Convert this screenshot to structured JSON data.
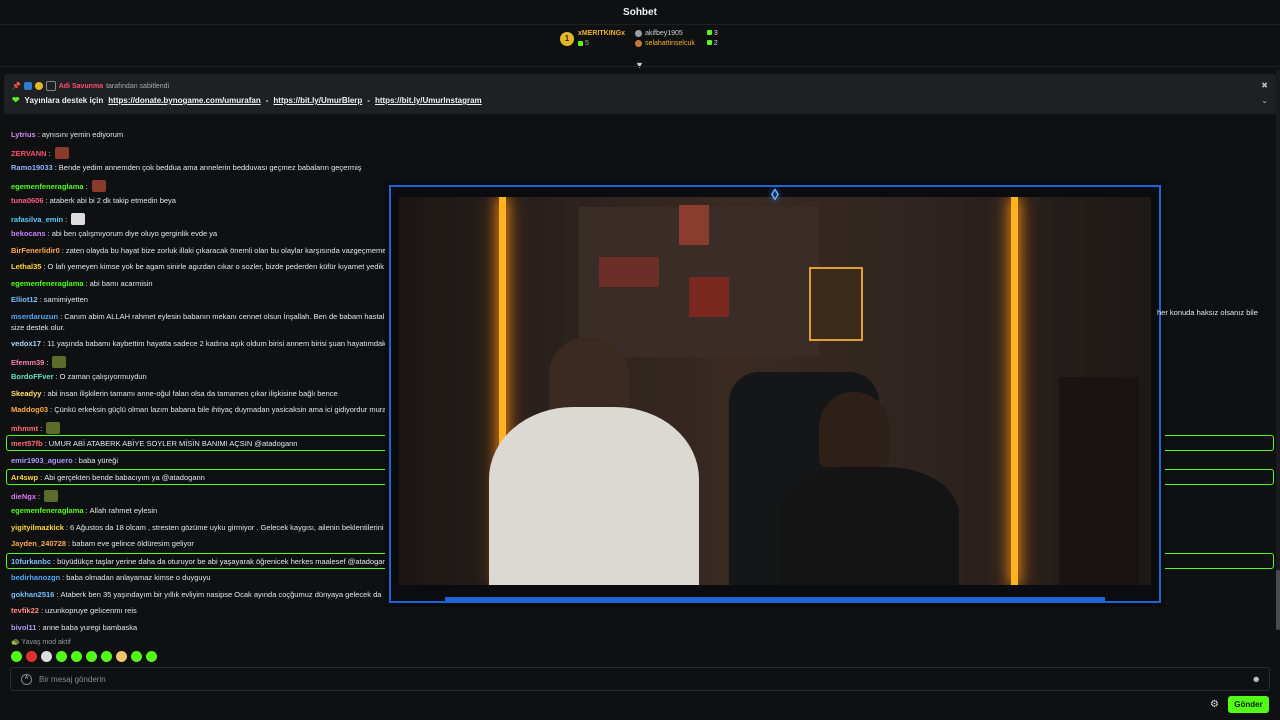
{
  "header": {
    "title": "Sohbet"
  },
  "leaderboard": {
    "first": {
      "rank": "1",
      "name": "xMERITKINGx",
      "count": "5"
    },
    "others": [
      {
        "name": "akifbey1905",
        "count": "3"
      },
      {
        "name": "selahattinselcuk",
        "count": "2"
      }
    ]
  },
  "pinned": {
    "pinned_by": "Adi Savunma",
    "pinned_suffix": "tarafından sabitlendi",
    "support_text": "Yayınlara destek için",
    "link1": "https://donate.bynogame.com/umurafan",
    "sep": "-",
    "link2": "https://bit.ly/UmurBlerp",
    "link3": "https://bit.ly/UmurInstagram"
  },
  "messages": [
    {
      "user": "Lytrius",
      "color": "#d48cff",
      "text": "aynısını yemin ediyorum"
    },
    {
      "user": "ZERVANN",
      "color": "#ff4d6d",
      "text": ""
    },
    {
      "user": "Ramo19033",
      "color": "#8ab4ff",
      "text": "Bende yedim annemden çok beddua ama annelerin bedduvası geçmez babaların geçermiş"
    },
    {
      "user": "egemenfeneraglama",
      "color": "#53fc18",
      "text": ""
    },
    {
      "user": "tuna0606",
      "color": "#ff5c8a",
      "text": "ataberk abi bi 2 dk takip etmedin beya"
    },
    {
      "user": "rafasilva_emin",
      "color": "#5cc8ff",
      "text": ""
    },
    {
      "user": "bekocans",
      "color": "#c77dff",
      "text": "abi ben çalışmıyorum diye oluyo gerginlik evde ya"
    },
    {
      "user": "BirFenerlidir0",
      "color": "#ffa94d",
      "text": "zaten olayda bu hayat bize zorluk illaki çıkaracak önemli olan bu olaylar karşısında vazgeçmemek"
    },
    {
      "user": "Lethal35",
      "color": "#ffd43b",
      "text": "O lafı yemeyen kimse yok be agam sinirle agızdan cıkar o sozler, bizde pederden küfür kıyamet yedik"
    },
    {
      "user": "egemenfeneraglama",
      "color": "#53fc18",
      "text": "abi bamı acarmisin"
    },
    {
      "user": "Elliot12",
      "color": "#74c0fc",
      "text": "samimiyetten"
    },
    {
      "user": "mserdaruzun",
      "color": "#4dabf7",
      "text": "Canım abim ALLAH rahmet eylesin babanın mekanı cennet olsun İnşallah. Ben de babam hastalıklı"
    },
    {
      "user": "",
      "color": "#e6e6e6",
      "text": "size destek olur."
    },
    {
      "user": "vedox17",
      "color": "#a5d8ff",
      "text": "11 yaşında babamı kaybettim hayatta sadece 2 kadına aşık oldum birisi annem birisi şuan hayatımdaki"
    },
    {
      "user": "Efemm39",
      "color": "#f783ac",
      "text": ""
    },
    {
      "user": "BordoFFver",
      "color": "#63e6be",
      "text": "O zaman çalışıyormuydun"
    },
    {
      "user": "Skeadyy",
      "color": "#ffe066",
      "text": "abi insan ilişkilerin tamamı anne-oğul falan olsa da tamamen çıkar ilişkisine bağlı bence"
    },
    {
      "user": "Maddog03",
      "color": "#ffa94d",
      "text": "Çünkü erkeksin güçlü olman lazım babana bile ihtiyaç duymadan yasicaksin ama ici gidiyordur murat"
    },
    {
      "user": "mhmmt",
      "color": "#ff6b6b",
      "text": ""
    },
    {
      "user": "mert57fb",
      "color": "#ff6b6b",
      "text": "UMUR ABİ ATABERK ABİYE SOYLER MİSİN BANIMI AÇSIN @atadogann"
    },
    {
      "user": "emir1903_aguero",
      "color": "#b197fc",
      "text": "baba yüreği"
    },
    {
      "user": "Ar4swp",
      "color": "#ffd43b",
      "text": "Abi gerçekten bende babacıyım ya @atadogann"
    },
    {
      "user": "dieNgx",
      "color": "#da77f2",
      "text": ""
    },
    {
      "user": "egemenfeneraglama",
      "color": "#53fc18",
      "text": "Allah rahmet eylesin"
    },
    {
      "user": "yigityilmazkick",
      "color": "#ffd43b",
      "text": "6 Ağustos da 18 olcam , stresten gözüme uyku girmiyor . Gelecek kaygısı, ailenin beklentilerini k"
    },
    {
      "user": "Jayden_240728",
      "color": "#ffa94d",
      "text": "babam eve gelince öldüresim geliyor"
    },
    {
      "user": "10furkanbc",
      "color": "#74c0fc",
      "text": "büyüdükçe taşlar yerine daha da oturuyor be abi yaşayarak öğrenicek herkes maalesef @atadogan"
    },
    {
      "user": "bedirhanozgn",
      "color": "#4dabf7",
      "text": "baba olmadan anlayamaz kimse o duyguyu"
    },
    {
      "user": "gokhan2516",
      "color": "#74c0fc",
      "text": "Ataberk ben 35 yaşındayım bir yıllık evliyim nasipse Ocak ayında coçğumuz dünyaya gelecek da"
    },
    {
      "user": "tevfik22",
      "color": "#ff8787",
      "text": "uzunkopruye gelıcenmı reis"
    },
    {
      "user": "bivol11",
      "color": "#b197fc",
      "text": "anne baba yuregi bambaska"
    }
  ],
  "overflow_right": "her konuda haksız olsanız bile",
  "slow_mode": "Yavaş mod aktif",
  "input": {
    "placeholder": "Bir mesaj gönderin"
  },
  "send_label": "Gönder",
  "colors": {
    "accent": "#53fc18",
    "overlay_frame": "#1f64d6"
  }
}
